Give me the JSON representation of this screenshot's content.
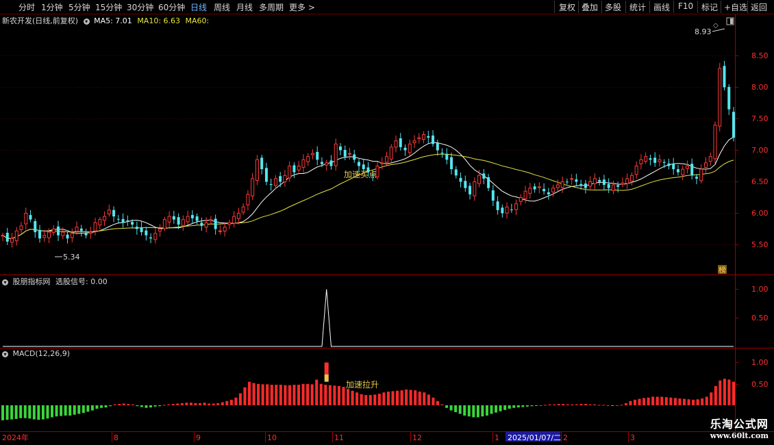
{
  "toolbar": {
    "periods": [
      "分时",
      "1分钟",
      "5分钟",
      "15分钟",
      "30分钟",
      "60分钟",
      "日线",
      "周线",
      "月线",
      "多周期",
      "更多"
    ],
    "active_period": "日线",
    "more_arrow": ">",
    "actions": [
      "复权",
      "叠加",
      "多股",
      "统计",
      "画线",
      "F10",
      "标记",
      "+自选",
      "返回"
    ]
  },
  "price_panel": {
    "title": "新农开发(日线,前复权)",
    "ma5_label": "MA5: 7.01",
    "ma10_label": "MA10: 6.63",
    "ma60_label": "MA60:",
    "high_label": "8.93",
    "low_label": "5.34",
    "annotation": "加速买点",
    "rank_badge": "榜",
    "yticks": [
      "8.50",
      "8.00",
      "7.50",
      "7.00",
      "6.50",
      "6.00",
      "5.50"
    ],
    "colors": {
      "up": "#ff3a3a",
      "down": "#54e6f0",
      "ma5": "#ffffff",
      "ma10": "#e6e640"
    }
  },
  "indicator_panel": {
    "title": "股朋指标网",
    "signal_label": "选股信号: 0.00",
    "yticks": [
      "1.00",
      "0.50"
    ]
  },
  "macd_panel": {
    "title": "MACD(12,26,9)",
    "annotation": "加速拉升",
    "yticks": [
      "1.00",
      "0.50"
    ]
  },
  "date_axis": {
    "labels": [
      "2024年",
      "8",
      "9",
      "10",
      "11",
      "12",
      "1",
      "2",
      "3"
    ],
    "cursor_date": "2025/01/07/二"
  },
  "watermark": {
    "line1": "乐淘公式网",
    "line2": "www.60lt.com"
  },
  "chart_data": [
    {
      "type": "candlestick",
      "title": "新农开发(日线,前复权)",
      "series_names": [
        "MA5",
        "MA10",
        "MA60"
      ],
      "ylim": [
        5.1,
        8.95
      ],
      "high": 8.93,
      "low": 5.34,
      "close": [
        5.65,
        5.55,
        5.6,
        5.72,
        5.8,
        6.0,
        5.9,
        5.7,
        5.6,
        5.65,
        5.7,
        5.75,
        5.65,
        5.7,
        5.6,
        5.68,
        5.78,
        5.72,
        5.65,
        5.7,
        5.85,
        5.9,
        5.95,
        6.05,
        5.95,
        5.9,
        5.85,
        5.88,
        5.82,
        5.75,
        5.7,
        5.65,
        5.6,
        5.68,
        5.75,
        5.9,
        5.95,
        5.9,
        5.82,
        5.9,
        5.95,
        5.92,
        5.88,
        5.8,
        5.85,
        5.9,
        5.75,
        5.72,
        5.78,
        5.85,
        5.95,
        6.0,
        6.1,
        6.3,
        6.55,
        6.85,
        6.7,
        6.5,
        6.45,
        6.55,
        6.5,
        6.6,
        6.75,
        6.65,
        6.75,
        6.85,
        6.9,
        6.95,
        6.85,
        6.78,
        6.8,
        6.75,
        7.1,
        7.0,
        6.9,
        6.95,
        6.85,
        6.75,
        6.7,
        6.65,
        6.6,
        6.75,
        6.8,
        6.9,
        7.05,
        7.15,
        7.05,
        7.0,
        7.1,
        7.15,
        7.2,
        7.25,
        7.2,
        7.1,
        7.0,
        6.95,
        6.85,
        6.7,
        6.6,
        6.5,
        6.4,
        6.3,
        6.5,
        6.6,
        6.55,
        6.4,
        6.2,
        6.05,
        6.0,
        6.1,
        6.05,
        6.15,
        6.25,
        6.35,
        6.4,
        6.38,
        6.42,
        6.35,
        6.3,
        6.4,
        6.45,
        6.5,
        6.5,
        6.55,
        6.5,
        6.45,
        6.4,
        6.5,
        6.55,
        6.5,
        6.45,
        6.4,
        6.45,
        6.42,
        6.48,
        6.55,
        6.6,
        6.75,
        6.85,
        6.9,
        6.85,
        6.8,
        6.85,
        6.8,
        6.75,
        6.7,
        6.65,
        6.7,
        6.75,
        6.6,
        6.55,
        6.7,
        6.8,
        6.9,
        7.4,
        8.3,
        8.0,
        7.65,
        7.2
      ],
      "ma5_last": 7.01,
      "ma10_last": 6.63
    },
    {
      "type": "line",
      "title": "股朋指标网",
      "series_names": [
        "选股信号"
      ],
      "ylim": [
        0,
        1.2
      ],
      "spike_index": 70,
      "spike_value": 1.0,
      "last_value": 0.0
    },
    {
      "type": "bar",
      "title": "MACD(12,26,9)",
      "ylim": [
        -0.45,
        1.25
      ],
      "values": [
        -0.35,
        -0.34,
        -0.33,
        -0.32,
        -0.3,
        -0.3,
        -0.31,
        -0.33,
        -0.34,
        -0.33,
        -0.31,
        -0.28,
        -0.26,
        -0.25,
        -0.24,
        -0.24,
        -0.22,
        -0.2,
        -0.18,
        -0.15,
        -0.12,
        -0.08,
        -0.06,
        -0.05,
        -0.02,
        0.02,
        0.03,
        0.04,
        0.03,
        0.02,
        -0.02,
        -0.04,
        -0.06,
        -0.05,
        -0.03,
        -0.02,
        0.01,
        0.02,
        0.03,
        0.04,
        0.05,
        0.06,
        0.06,
        0.05,
        0.05,
        0.06,
        0.04,
        0.04,
        0.05,
        0.07,
        0.1,
        0.13,
        0.18,
        0.28,
        0.42,
        0.55,
        0.52,
        0.5,
        0.49,
        0.49,
        0.48,
        0.48,
        0.48,
        0.47,
        0.47,
        0.48,
        0.48,
        0.5,
        0.5,
        0.49,
        0.6,
        0.5,
        0.48,
        0.47,
        0.46,
        0.45,
        0.43,
        0.38,
        0.34,
        0.3,
        0.26,
        0.24,
        0.24,
        0.25,
        0.27,
        0.3,
        0.32,
        0.33,
        0.34,
        0.35,
        0.37,
        0.36,
        0.35,
        0.32,
        0.3,
        0.25,
        0.18,
        0.1,
        0.02,
        -0.06,
        -0.12,
        -0.16,
        -0.2,
        -0.24,
        -0.26,
        -0.28,
        -0.28,
        -0.26,
        -0.24,
        -0.2,
        -0.17,
        -0.14,
        -0.11,
        -0.08,
        -0.06,
        -0.05,
        -0.04,
        -0.03,
        -0.02,
        -0.01,
        0.0,
        0.01,
        0.02,
        0.02,
        0.03,
        0.03,
        0.02,
        0.02,
        0.02,
        0.03,
        0.03,
        0.02,
        0.02,
        0.01,
        0.01,
        0.0,
        -0.01,
        0.0,
        0.01,
        0.05,
        0.1,
        0.13,
        0.15,
        0.17,
        0.18,
        0.2,
        0.2,
        0.2,
        0.19,
        0.18,
        0.17,
        0.16,
        0.15,
        0.14,
        0.13,
        0.14,
        0.16,
        0.2,
        0.3,
        0.45,
        0.58,
        0.62,
        0.6,
        0.55
      ]
    }
  ]
}
